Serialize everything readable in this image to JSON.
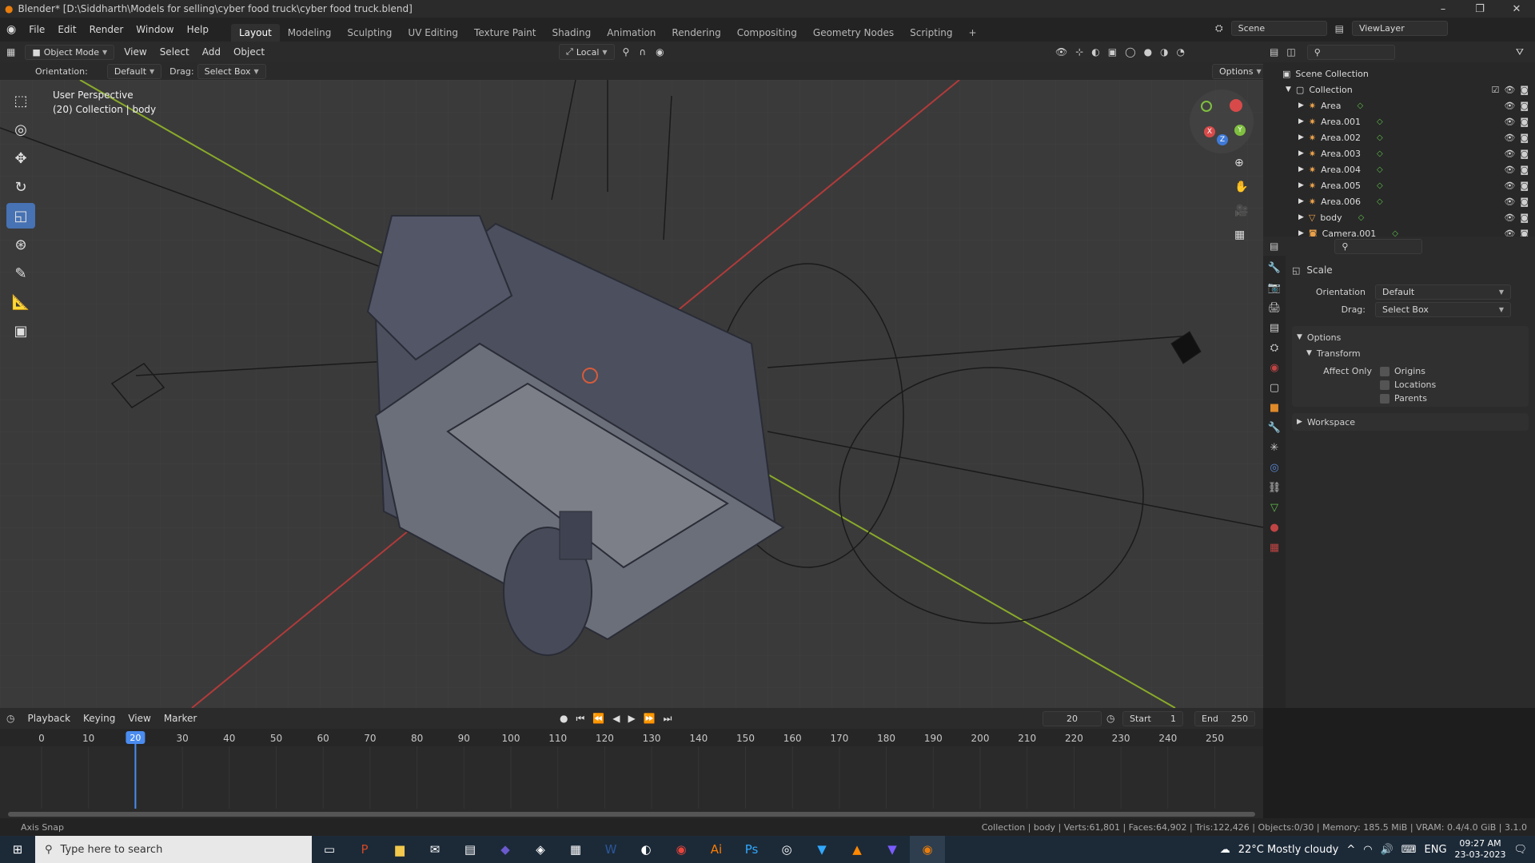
{
  "window": {
    "title": "Blender* [D:\\Siddharth\\Models for selling\\cyber food truck\\cyber food truck.blend]",
    "controls": [
      "minimize-icon",
      "maximize-icon",
      "close-icon"
    ]
  },
  "menubar": {
    "menus": [
      "File",
      "Edit",
      "Render",
      "Window",
      "Help"
    ],
    "workspaces": [
      "Layout",
      "Modeling",
      "Sculpting",
      "UV Editing",
      "Texture Paint",
      "Shading",
      "Animation",
      "Rendering",
      "Compositing",
      "Geometry Nodes",
      "Scripting"
    ],
    "active_workspace": "Layout",
    "scene": "Scene",
    "view_layer": "ViewLayer"
  },
  "viewport_header": {
    "mode": "Object Mode",
    "menus": [
      "View",
      "Select",
      "Add",
      "Object"
    ],
    "transform_pivot": "Local",
    "options_label": "Options"
  },
  "tool_settings": {
    "orientation_label": "Orientation:",
    "orientation_value": "Default",
    "drag_label": "Drag:",
    "drag_value": "Select Box"
  },
  "viewport": {
    "perspective_label": "User Perspective",
    "collection_label": "(20) Collection | body",
    "gizmo_axes": [
      "X",
      "Y",
      "Z"
    ]
  },
  "toolbar": {
    "tools": [
      "select-box-icon",
      "cursor-icon",
      "move-icon",
      "rotate-icon",
      "scale-icon",
      "transform-icon",
      "annotate-icon",
      "measure-icon",
      "add-cube-icon"
    ],
    "active_tool": "scale-icon"
  },
  "outliner": {
    "root": "Scene Collection",
    "collection": "Collection",
    "items": [
      {
        "name": "Area",
        "type": "light"
      },
      {
        "name": "Area.001",
        "type": "light"
      },
      {
        "name": "Area.002",
        "type": "light"
      },
      {
        "name": "Area.003",
        "type": "light"
      },
      {
        "name": "Area.004",
        "type": "light"
      },
      {
        "name": "Area.005",
        "type": "light"
      },
      {
        "name": "Area.006",
        "type": "light"
      },
      {
        "name": "body",
        "type": "mesh"
      },
      {
        "name": "Camera.001",
        "type": "camera"
      }
    ]
  },
  "properties": {
    "tool_name": "Scale",
    "orientation_label": "Orientation",
    "orientation_value": "Default",
    "drag_label": "Drag:",
    "drag_value": "Select Box",
    "options_section": "Options",
    "transform_section": "Transform",
    "affect_only_label": "Affect Only",
    "checkboxes": [
      "Origins",
      "Locations",
      "Parents"
    ],
    "workspace_section": "Workspace"
  },
  "timeline": {
    "menus": [
      "Playback",
      "Keying",
      "View",
      "Marker"
    ],
    "current_frame": "20",
    "start_label": "Start",
    "start_value": "1",
    "end_label": "End",
    "end_value": "250",
    "ruler_ticks": [
      "0",
      "10",
      "20",
      "30",
      "40",
      "50",
      "60",
      "70",
      "80",
      "90",
      "100",
      "110",
      "120",
      "130",
      "140",
      "150",
      "160",
      "170",
      "180",
      "190",
      "200",
      "210",
      "220",
      "230",
      "240",
      "250"
    ],
    "playhead_frame": 20
  },
  "statusbar": {
    "left": "Axis Snap",
    "right": "Collection | body | Verts:61,801 | Faces:64,902 | Tris:122,426 | Objects:0/30 | Memory: 185.5 MiB | VRAM: 0.4/4.0 GiB | 3.1.0"
  },
  "taskbar": {
    "search_placeholder": "Type here to search",
    "weather": "22°C  Mostly cloudy",
    "language": "ENG",
    "time": "09:27 AM",
    "date": "23-03-2023"
  }
}
